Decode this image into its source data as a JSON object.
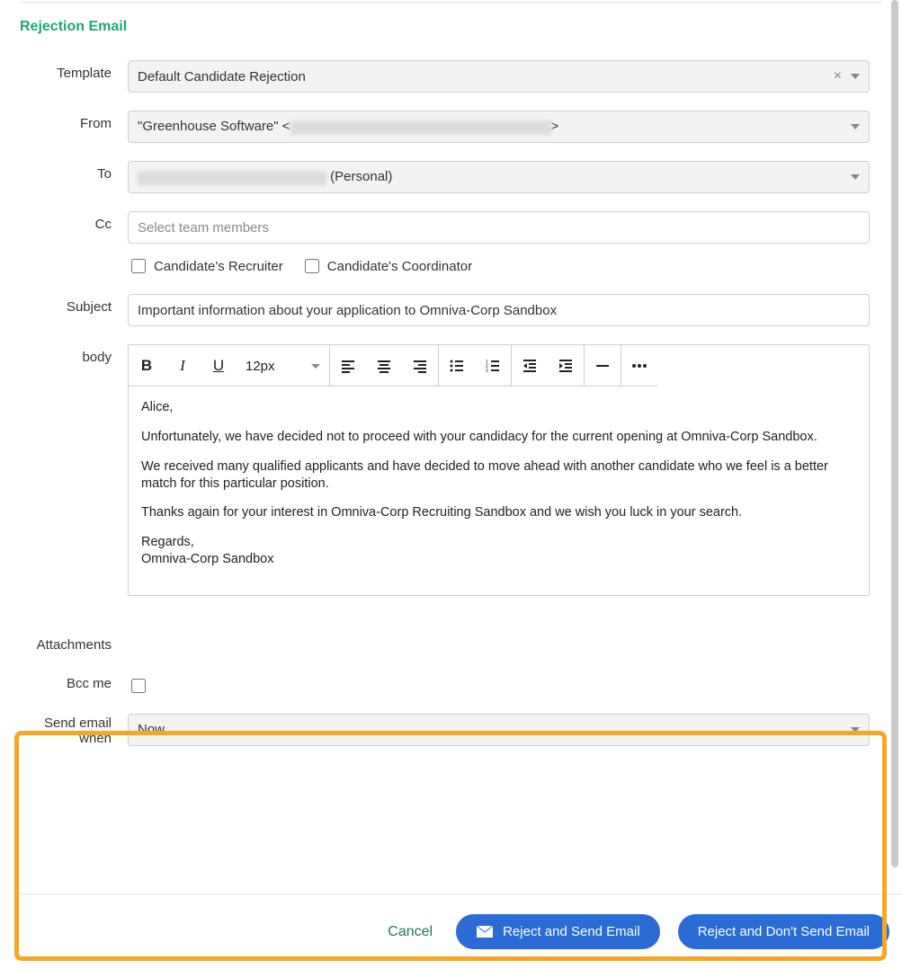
{
  "section": {
    "title": "Rejection Email"
  },
  "labels": {
    "template": "Template",
    "from": "From",
    "to": "To",
    "cc": "Cc",
    "subject": "Subject",
    "body": "body",
    "attachments": "Attachments",
    "bcc_me": "Bcc me",
    "send_when": "Send email when"
  },
  "template": {
    "value": "Default Candidate Rejection"
  },
  "from": {
    "prefix": "\"Greenhouse Software\" <",
    "suffix": ">"
  },
  "to": {
    "suffix": " (Personal)"
  },
  "cc": {
    "placeholder": "Select team members",
    "recruiter_label": "Candidate's Recruiter",
    "coordinator_label": "Candidate's Coordinator"
  },
  "subject": {
    "value": "Important information about your application to Omniva-Corp Sandbox"
  },
  "editor": {
    "font_size": "12px",
    "body": {
      "p1": "Alice,",
      "p2": "Unfortunately, we have decided not to proceed with your candidacy for the current opening at Omniva-Corp Sandbox.",
      "p3": "We received many qualified applicants and have decided to move ahead with another candidate who we feel is a better match for this particular position.",
      "p4": "Thanks again for your interest in Omniva-Corp Recruiting Sandbox and we wish you luck in your search.",
      "p5a": "Regards,",
      "p5b": "Omniva-Corp Sandbox"
    }
  },
  "send_when": {
    "value": "Now"
  },
  "buttons": {
    "cancel": "Cancel",
    "reject_send": "Reject and Send Email",
    "reject_nosend": "Reject and Don't Send Email"
  }
}
